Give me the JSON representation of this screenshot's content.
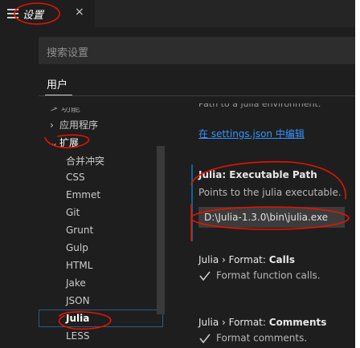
{
  "tab": {
    "label": "设置",
    "close": "×"
  },
  "search": {
    "placeholder": "搜索设置"
  },
  "scope": {
    "user": "用户"
  },
  "tree": {
    "cut_top": "> 功能",
    "app": "应用程序",
    "extensions": "扩展",
    "items": [
      "合并冲突",
      "CSS",
      "Emmet",
      "Git",
      "Grunt",
      "Gulp",
      "HTML",
      "Jake",
      "JSON",
      "Julia",
      "LESS"
    ]
  },
  "panel": {
    "cut_desc": "Path to a julia environment.",
    "edit_link": "在 settings.json 中编辑",
    "exec": {
      "title": "Julia: Executable Path",
      "desc": "Points to the julia executable.",
      "value": "D:\\Julia-1.3.0\\bin\\julia.exe"
    },
    "calls": {
      "prefix": "Julia › Format: ",
      "name": "Calls",
      "checkbox_label": "Format function calls."
    },
    "comments": {
      "prefix": "Julia › Format: ",
      "name": "Comments",
      "checkbox_label": "Format comments."
    }
  },
  "colors": {
    "accent": "#3794ff",
    "annotation": "#e51400",
    "background": "#1e1e1e"
  }
}
